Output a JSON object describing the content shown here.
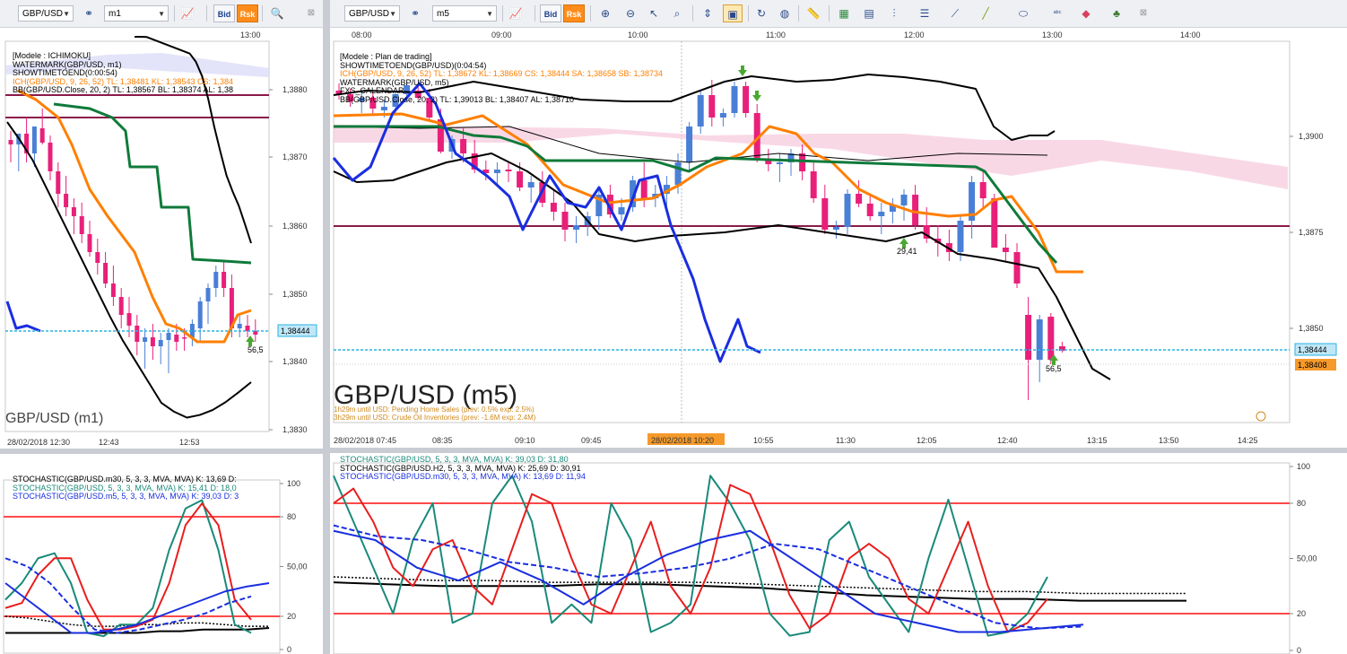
{
  "left_toolbar": {
    "symbol": "GBP/USD",
    "timeframe": "m1",
    "bid_label": "Bid",
    "rsk_label": "Rsk",
    "icons": [
      "link-icon",
      "chart-line-icon",
      "magnifier-icon",
      "pin-icon"
    ]
  },
  "right_toolbar": {
    "symbol": "GBP/USD",
    "timeframe": "m5",
    "bid_label": "Bid",
    "rsk_label": "Rsk",
    "icons": [
      "link-icon",
      "chart-line-icon",
      "zoom-in-icon",
      "zoom-out-icon",
      "cursor-icon",
      "zoom-area-icon",
      "fit-icon",
      "select-icon",
      "rotate-icon",
      "globe-icon",
      "ruler-icon",
      "image-icon",
      "screenshot-icon",
      "fork-icon",
      "lines-icon",
      "fan-icon",
      "pencil-icon",
      "ellipse-icon",
      "abc-icon",
      "eraser-icon",
      "tree-icon",
      "pin-icon"
    ]
  },
  "colors": {
    "bull_candle": "#4a7fd6",
    "bear_candle": "#e8207a",
    "ichimoku_kijun": "#0f7a3a",
    "ichimoku_tenkan": "#ff7f00",
    "bollinger": "#000000",
    "price_line": "#2bb3e0",
    "horizontal_line": "#8b1a4a",
    "cloud": "#f7c8dc",
    "stoch_k": "#1a8a7a",
    "stoch_d": "#e81e1e",
    "stoch_blue": "#1a2ee0",
    "level_line": "#ff4a4a"
  },
  "chart_data": [
    {
      "type": "line",
      "panel": "left-main",
      "title": "GBP/USD (m1)",
      "time_top": [
        "13:00"
      ],
      "time_bottom": [
        "28/02/2018 12:30",
        "12:43",
        "12:53"
      ],
      "price_ticks": [
        "1,3880",
        "1,3870",
        "1,3860",
        "1,3850",
        "1,3840",
        "1,3830"
      ],
      "ylim": [
        1.3828,
        1.389
      ],
      "current_price": "1,38444",
      "current_price_value": 1.38444,
      "legend": [
        "[Modele : ICHIMOKU]",
        "WATERMARK(GBP/USD, m1)",
        "SHOWTIMETOEND(0:00:54)",
        "ICH(GBP/USD, 9, 26, 52) TL: 1,38481  KL: 1,38543  CS: 1,384",
        "BB(GBP/USD.Close, 20, 2)  TL: 1,38567  BL: 1,38374  AL: 1,38"
      ],
      "annotation": "56,5"
    },
    {
      "type": "line",
      "panel": "right-main",
      "title": "GBP/USD (m5)",
      "time_top": [
        "08:00",
        "09:00",
        "10:00",
        "11:00",
        "12:00",
        "13:00",
        "14:00"
      ],
      "time_bottom": [
        "28/02/2018 07:45",
        "08:35",
        "09:10",
        "09:45",
        "28/02/2018 10:20",
        "10:55",
        "11:30",
        "12:05",
        "12:40",
        "13:15",
        "13:50",
        "14:25"
      ],
      "price_ticks": [
        "1,3900",
        "1,3875",
        "1,3850"
      ],
      "ylim": [
        1.382,
        1.3915
      ],
      "current_price": "1,38444",
      "current_price_value": 1.38444,
      "second_price": "1,38408",
      "second_price_value": 1.38408,
      "legend": [
        "[Modele : Plan de trading]",
        "SHOWTIMETOEND(GBP/USD)(0:04:54)",
        "ICH(GBP/USD, 9, 26, 52) TL: 1,38672  KL: 1,38669  CS: 1,38444  SA: 1,38658  SB: 1,38734",
        "WATERMARK(GBP/USD, m5)",
        "FXS_CALENDAR",
        "BB(GBP/USD.Close, 20, 2)  TL: 1,39013  BL: 1,38407  AL: 1,38710"
      ],
      "calendar": [
        "1h29m until USD: Pending Home Sales (prev: 0.5% exp: 2.5%)",
        "3h29m until USD: Crude Oil Inventories (prev: -1.6M exp: 2.4M)"
      ],
      "annotations": [
        "29,41",
        "56,5"
      ]
    },
    {
      "type": "line",
      "panel": "left-stochastic",
      "ylim": [
        0,
        100
      ],
      "tick_labels": [
        "100",
        "80",
        "50,00",
        "20",
        "0"
      ],
      "levels": [
        80,
        20
      ],
      "legend": [
        "STOCHASTIC(GBP/USD.m30, 5, 3, 3, MVA, MVA)  K: 13,69  D:",
        "STOCHASTIC(GBP/USD, 5, 3, 3, MVA, MVA)  K: 15,41  D: 18,0",
        "STOCHASTIC(GBP/USD.m5, 5, 3, 3, MVA, MVA)  K: 39,03  D: 3"
      ]
    },
    {
      "type": "line",
      "panel": "right-stochastic",
      "ylim": [
        0,
        100
      ],
      "tick_labels": [
        "100",
        "80",
        "50,00",
        "20",
        "0"
      ],
      "levels": [
        80,
        20
      ],
      "legend": [
        "STOCHASTIC(GBP/USD, 5, 3, 3, MVA, MVA)  K: 39,03  D: 31,80",
        "STOCHASTIC(GBP/USD.H2, 5, 3, 3, MVA, MVA)  K: 25,69  D: 30,91",
        "STOCHASTIC(GBP/USD.m30, 5, 3, 3, MVA, MVA)  K: 13,69  D: 11,94"
      ]
    }
  ]
}
